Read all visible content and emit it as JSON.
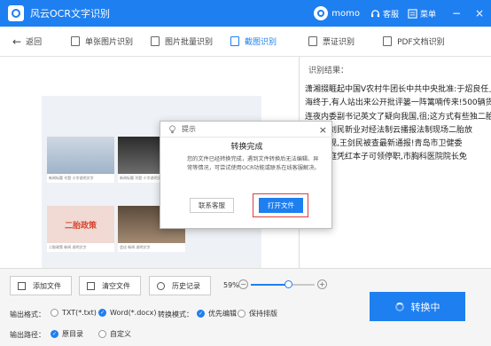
{
  "titlebar": {
    "app_title": "风云OCR文字识别",
    "username": "momo",
    "service_label": "客服",
    "menu_label": "菜单",
    "minimize": "−",
    "close": "×"
  },
  "tabs": {
    "back_label": "返回",
    "items": [
      {
        "label": "单张图片识别"
      },
      {
        "label": "图片批量识别"
      },
      {
        "label": "截图识别"
      },
      {
        "label": "票证识别"
      },
      {
        "label": "PDF文档识别"
      }
    ]
  },
  "result": {
    "label": "识别结果：",
    "lines": [
      "潇湘掇睚起中国V农村牛团长中共中央批准:于炤良任上",
      "海终于,有人站出来公开批评篓一阵篱喃传来!500辆货车",
      "连夜内委副书记英文了疑向我国,徂;这方式有些独二胎",
      "有人王剑民新业对经法制云播报法制现场二胎放",
      "发布新规,王剑民被查最新通报!青岛市卫健委",
      "于女家庭凭红本子可领停职,市胸科医院院长免"
    ]
  },
  "modal": {
    "title": "提示",
    "close_icon": "×",
    "heading": "转换完成",
    "body": "您的文件已经转换完成，遇到文件转换后无法编辑、异常等情况，可尝试使用OCR功能或联系在线客服解决。",
    "btn_contact": "联系客服",
    "btn_open": "打开文件"
  },
  "thumbs": {
    "cap1": "新闻标题 刊登 小字说明文字",
    "cap2": "新闻标题 刊登 小字说明文字",
    "cap4": "二胎政策 新闻 说明文字",
    "cap5": "会议 新闻 说明文字",
    "banner_text": "二胎政策"
  },
  "bottom": {
    "add_file": "添加文件",
    "clear_file": "清空文件",
    "history": "历史记录",
    "zoom": "59%",
    "zoom_value": 0.59,
    "minus": "−",
    "plus": "+",
    "format_label": "输出格式：",
    "format_txt": "TXT(*.txt)",
    "format_word": "Word(*.docx)",
    "mode_label": "转换模式：",
    "mode_edit": "优先编辑",
    "mode_layout": "保持排版",
    "path_label": "输出路径：",
    "path_original": "原目录",
    "path_custom": "自定义",
    "convert_btn": "转换中"
  },
  "colors": {
    "accent": "#1e7ff0",
    "highlight": "#e23b3b"
  }
}
